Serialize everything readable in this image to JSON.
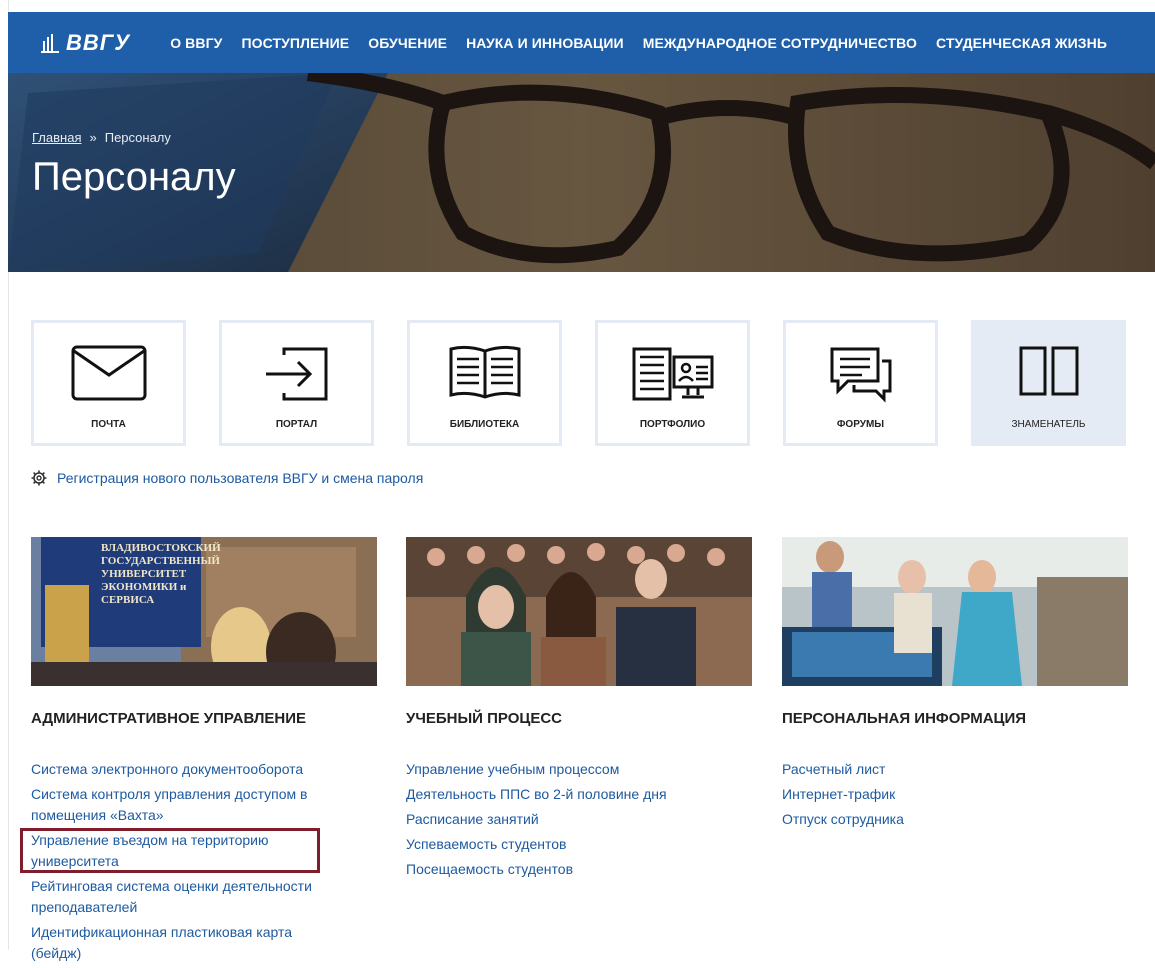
{
  "header": {
    "logo_text": "ВВГУ",
    "nav": [
      "О ВВГУ",
      "ПОСТУПЛЕНИЕ",
      "ОБУЧЕНИЕ",
      "НАУКА И ИННОВАЦИИ",
      "МЕЖДУНАРОДНОЕ СОТРУДНИЧЕСТВО",
      "СТУДЕНЧЕСКАЯ ЖИЗНЬ"
    ]
  },
  "breadcrumb": {
    "home": "Главная",
    "separator": "»",
    "current": "Персоналу"
  },
  "page_title": "Персоналу",
  "tiles": [
    {
      "label": "ПОЧТА",
      "icon": "envelope-icon"
    },
    {
      "label": "ПОРТАЛ",
      "icon": "login-icon"
    },
    {
      "label": "БИБЛИОТЕКА",
      "icon": "book-icon"
    },
    {
      "label": "ПОРТФОЛИО",
      "icon": "portfolio-icon"
    },
    {
      "label": "ФОРУМЫ",
      "icon": "chat-icon"
    },
    {
      "label": "ЗНАМЕНАТЕЛЬ",
      "icon": "week-parity-icon"
    }
  ],
  "registration_link": "Регистрация нового пользователя ВВГУ и смена пароля",
  "columns": [
    {
      "title": "АДМИНИСТРАТИВНОЕ УПРАВЛЕНИЕ",
      "links": [
        "Система электронного документооборота",
        "Система контроля управления доступом в помещения «Вахта»",
        "Управление въездом на территорию университета",
        "Рейтинговая система оценки деятельности преподавателей",
        "Идентификационная пластиковая карта (бейдж)"
      ]
    },
    {
      "title": "УЧЕБНЫЙ ПРОЦЕСС",
      "links": [
        "Управление учебным процессом",
        "Деятельность ППС во 2-й половине дня",
        "Расписание занятий",
        "Успеваемость студентов",
        "Посещаемость студентов"
      ]
    },
    {
      "title": "ПЕРСОНАЛЬНАЯ ИНФОРМАЦИЯ",
      "links": [
        "Расчетный лист",
        "Интернет-трафик",
        "Отпуск сотрудника"
      ]
    }
  ],
  "photo_sign": [
    "ВЛАДИВОСТОКСКИЙ",
    "ГОСУДАРСТВЕННЫЙ",
    "УНИВЕРСИТЕТ",
    "ЭКОНОМИКИ и",
    "СЕРВИСА"
  ],
  "colors": {
    "header_bg": "#1f5ea8",
    "link": "#1e5aa0",
    "highlight_border": "#7f1d2c",
    "tile_border": "#e3eaf3"
  }
}
